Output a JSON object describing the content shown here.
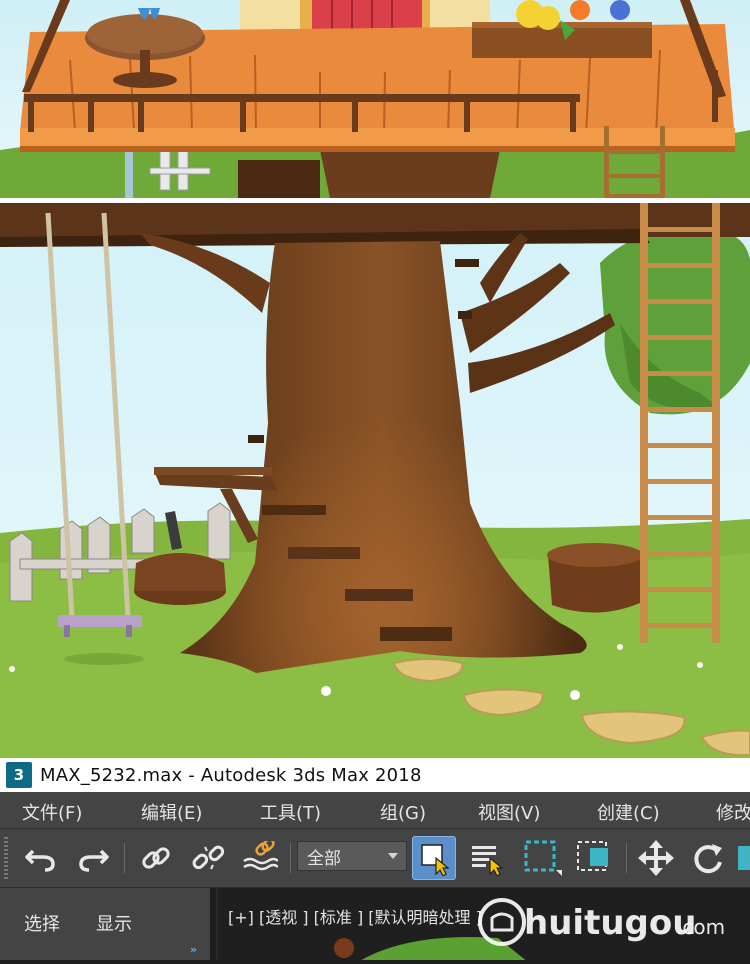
{
  "window": {
    "logo_text": "3",
    "title": "MAX_5232.max - Autodesk 3ds Max 2018"
  },
  "menu": {
    "items": [
      {
        "label": "文件(F)"
      },
      {
        "label": "编辑(E)"
      },
      {
        "label": "工具(T)"
      },
      {
        "label": "组(G)"
      },
      {
        "label": "视图(V)"
      },
      {
        "label": "创建(C)"
      },
      {
        "label": "修改"
      }
    ]
  },
  "toolbar": {
    "selection_filter": "全部",
    "icons": [
      "undo-icon",
      "redo-icon",
      "link-icon",
      "unlink-icon",
      "bind-space-warp-icon",
      "select-object-icon",
      "select-by-name-icon",
      "rectangular-selection-region-icon",
      "window-crossing-icon",
      "move-icon",
      "rotate-icon",
      "scale-icon"
    ]
  },
  "command_panel": {
    "tabs": [
      {
        "label": "选择"
      },
      {
        "label": "显示"
      }
    ],
    "expand_glyph": "»"
  },
  "viewport": {
    "label": "[+] [透视 ] [标准 ] [默认明暗处理 ]"
  },
  "watermark": {
    "text": "huitugou",
    "suffix": ".com"
  },
  "colors": {
    "ui_background": "#444444",
    "active_tool": "#5b8fc9",
    "selection_accent": "#3fb6c6",
    "cursor_yellow": "#f2c300"
  }
}
